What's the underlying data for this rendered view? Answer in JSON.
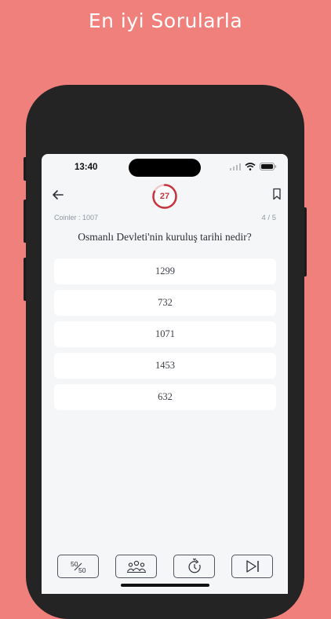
{
  "promo": {
    "title": "En iyi Sorularla"
  },
  "status_bar": {
    "time": "13:40"
  },
  "header": {
    "timer_value": "27",
    "timer_remaining_fraction": 0.82
  },
  "info": {
    "coins_label": "Coinler : 1007",
    "progress_text": "4 / 5"
  },
  "question": {
    "text": "Osmanlı Devleti'nin kuruluş tarihi nedir?",
    "options": [
      "1299",
      "732",
      "1071",
      "1453",
      "632"
    ]
  },
  "colors": {
    "accent": "#c9343e",
    "background": "#f0807c",
    "screen": "#f5f6f8"
  },
  "toolbar": {
    "icons": [
      "fifty-fifty-icon",
      "audience-icon",
      "extra-time-icon",
      "skip-icon"
    ]
  }
}
